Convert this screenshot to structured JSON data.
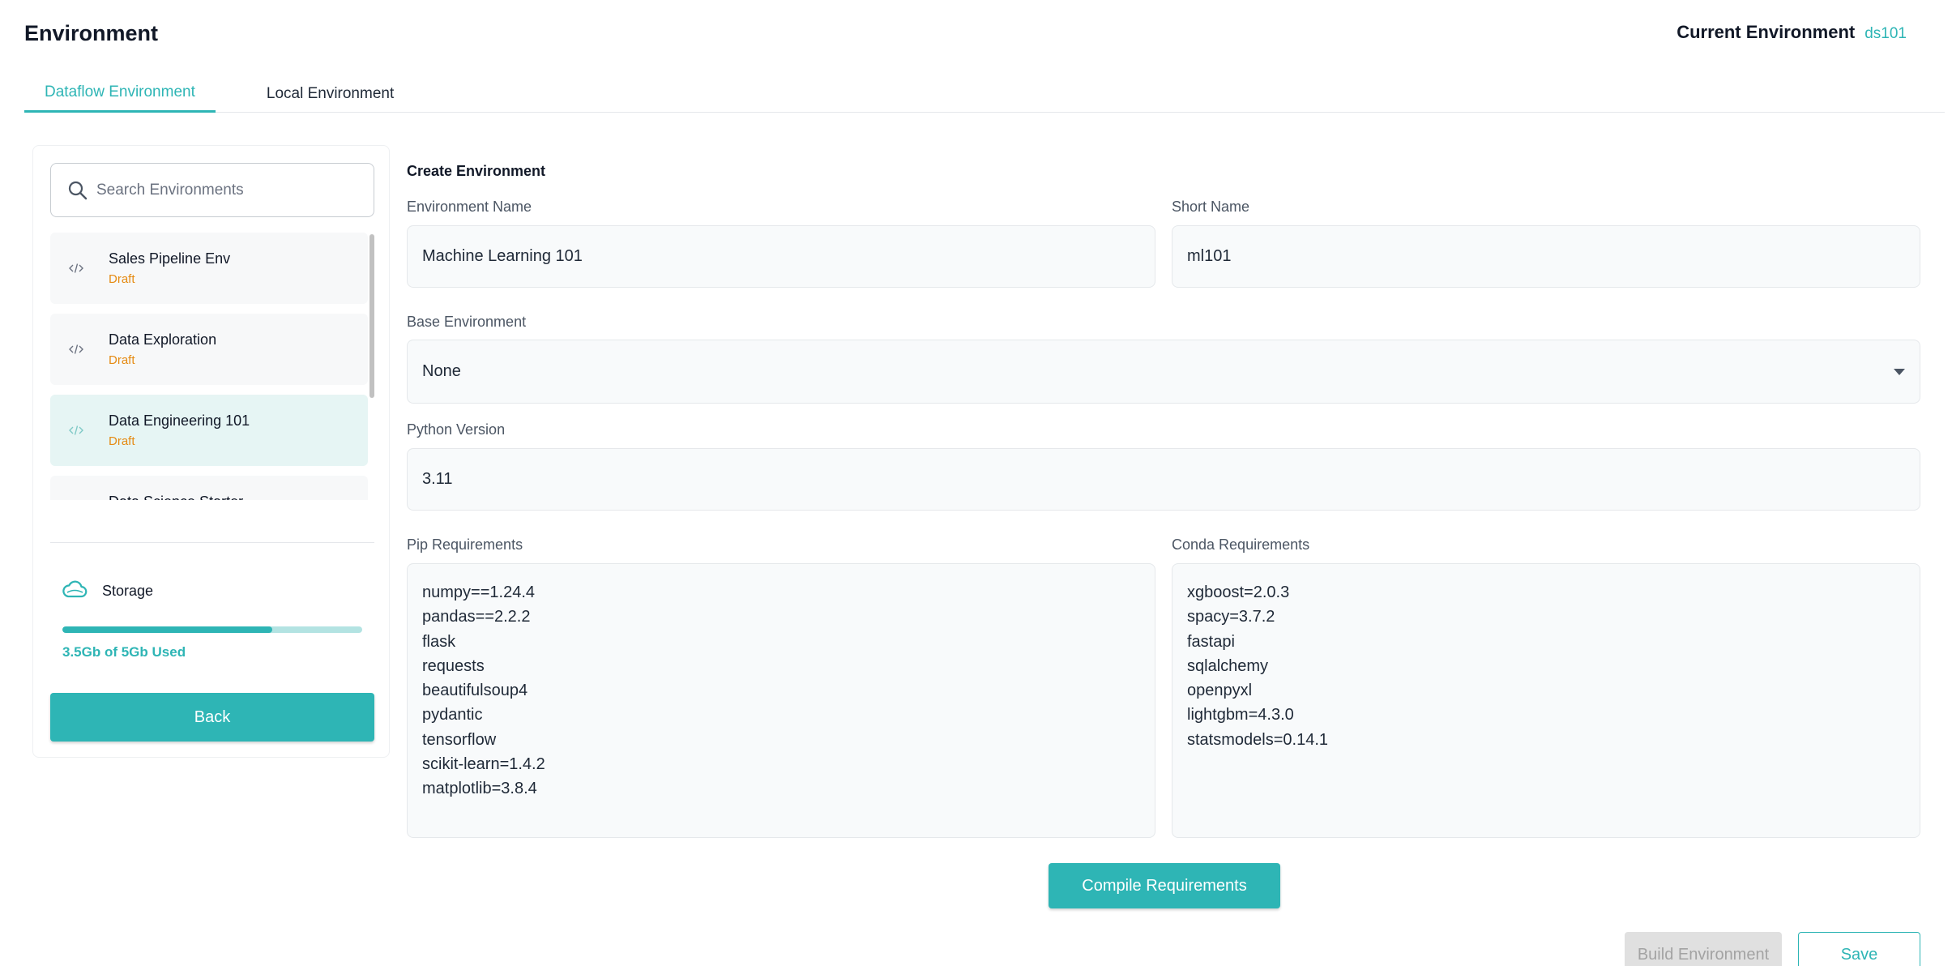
{
  "header": {
    "title": "Environment",
    "current_env_label": "Current Environment",
    "current_env_value": "ds101"
  },
  "tabs": [
    {
      "label": "Dataflow Environment",
      "active": true
    },
    {
      "label": "Local Environment",
      "active": false
    }
  ],
  "sidebar": {
    "search_placeholder": "Search Environments",
    "environments": [
      {
        "name": "Sales Pipeline Env",
        "status": "Draft",
        "selected": false
      },
      {
        "name": "Data Exploration",
        "status": "Draft",
        "selected": false
      },
      {
        "name": "Data Engineering 101",
        "status": "Draft",
        "selected": true
      },
      {
        "name": "Data Science Starter",
        "status": "",
        "selected": false
      }
    ],
    "storage_label": "Storage",
    "storage_used_text": "3.5Gb of 5Gb Used",
    "storage_fraction": 0.7,
    "back_label": "Back"
  },
  "form": {
    "heading": "Create Environment",
    "env_name_label": "Environment Name",
    "env_name_value": "Machine Learning 101",
    "short_name_label": "Short Name",
    "short_name_value": "ml101",
    "base_env_label": "Base Environment",
    "base_env_value": "None",
    "python_version_label": "Python Version",
    "python_version_value": "3.11",
    "pip_label": "Pip Requirements",
    "pip_lines": [
      "numpy==1.24.4",
      "pandas==2.2.2",
      "flask",
      "requests",
      "beautifulsoup4",
      "pydantic",
      "tensorflow",
      "scikit-learn=1.4.2",
      "matplotlib=3.8.4"
    ],
    "conda_label": "Conda Requirements",
    "conda_lines": [
      "xgboost=2.0.3",
      "spacy=3.7.2",
      "fastapi",
      "sqlalchemy",
      "openpyxl",
      "lightgbm=4.3.0",
      "statsmodels=0.14.1"
    ],
    "compile_label": "Compile Requirements",
    "build_label": "Build Environment",
    "save_label": "Save"
  },
  "colors": {
    "accent": "#2eb5b5",
    "draft": "#e58a12",
    "selected_bg": "#e6f5f4"
  },
  "icons": [
    "search-icon",
    "code-icon",
    "cloud-icon",
    "chevron-down-icon"
  ]
}
